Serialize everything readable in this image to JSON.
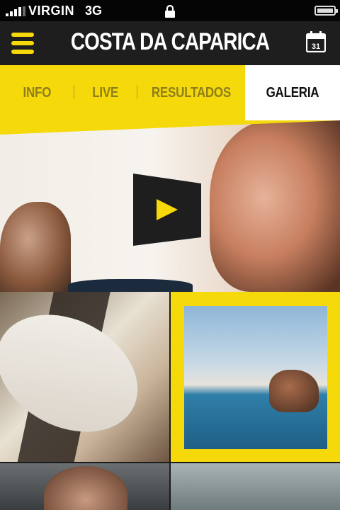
{
  "status_bar": {
    "carrier": "VIRGIN",
    "network": "3G",
    "icons": [
      "signal-icon",
      "lock-icon",
      "battery-icon"
    ]
  },
  "header": {
    "title": "COSTA DA CAPARICA",
    "menu_icon": "hamburger-menu-icon",
    "calendar_icon": "calendar-icon",
    "calendar_day": "31"
  },
  "tabs": [
    {
      "label": "INFO",
      "active": false
    },
    {
      "label": "LIVE",
      "active": false
    },
    {
      "label": "RESULTADOS",
      "active": false
    },
    {
      "label": "GALERIA",
      "active": true
    }
  ],
  "gallery": {
    "hero_icon": "play-icon",
    "accent_color": "#f5d90a"
  }
}
